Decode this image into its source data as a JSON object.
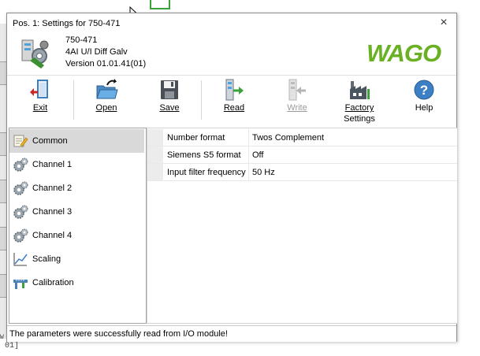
{
  "background": {
    "fragments": [
      "01]",
      "01]"
    ]
  },
  "window": {
    "title": "Pos. 1: Settings for 750-471",
    "close_glyph": "×"
  },
  "device": {
    "part_number": "750-471",
    "description": "4AI U/I Diff Galv",
    "version": "Version 01.01.41(01)",
    "logo_text": "WAGO",
    "logo_color": "#6ab023"
  },
  "toolbar": {
    "exit": "Exit",
    "open": "Open",
    "save": "Save",
    "read": "Read",
    "write": "Write",
    "factory_settings_line1": "Factory",
    "factory_settings_line2": "Settings",
    "help": "Help"
  },
  "nav": {
    "items": [
      {
        "label": "Common",
        "icon": "document-edit-icon",
        "selected": true
      },
      {
        "label": "Channel 1",
        "icon": "gears-icon"
      },
      {
        "label": "Channel 2",
        "icon": "gears-icon"
      },
      {
        "label": "Channel 3",
        "icon": "gears-icon"
      },
      {
        "label": "Channel 4",
        "icon": "gears-icon"
      },
      {
        "label": "Scaling",
        "icon": "line-graph-icon"
      },
      {
        "label": "Calibration",
        "icon": "caliper-icon"
      }
    ]
  },
  "properties": [
    {
      "name": "Number format",
      "value": "Twos Complement"
    },
    {
      "name": "Siemens S5 format",
      "value": "Off"
    },
    {
      "name": "Input filter frequency",
      "value": "50 Hz"
    }
  ],
  "status": {
    "message": "The parameters were successfully read from I/O module!"
  }
}
